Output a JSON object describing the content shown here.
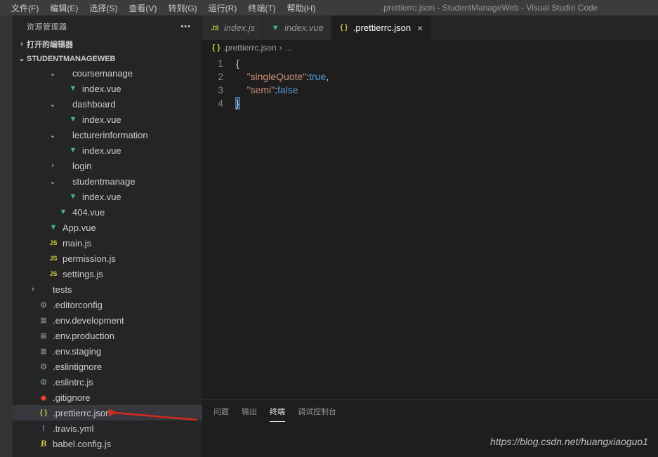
{
  "window": {
    "title": ".prettierrc.json - StudentManageWeb - Visual Studio Code"
  },
  "menu": [
    "文件(F)",
    "编辑(E)",
    "选择(S)",
    "查看(V)",
    "转到(G)",
    "运行(R)",
    "终端(T)",
    "帮助(H)"
  ],
  "sidebar": {
    "title": "资源管理器",
    "section_open_editors": "打开的编辑器",
    "project": "STUDENTMANAGEWEB"
  },
  "tree": [
    {
      "d": 3,
      "c": "down",
      "i": "folder",
      "t": "coursemanage"
    },
    {
      "d": 4,
      "c": "none",
      "i": "vue",
      "t": "index.vue"
    },
    {
      "d": 3,
      "c": "down",
      "i": "folder",
      "t": "dashboard"
    },
    {
      "d": 4,
      "c": "none",
      "i": "vue",
      "t": "index.vue"
    },
    {
      "d": 3,
      "c": "down",
      "i": "folder",
      "t": "lecturerinformation"
    },
    {
      "d": 4,
      "c": "none",
      "i": "vue",
      "t": "index.vue"
    },
    {
      "d": 3,
      "c": "right",
      "i": "folder",
      "t": "login"
    },
    {
      "d": 3,
      "c": "down",
      "i": "folder",
      "t": "studentmanage"
    },
    {
      "d": 4,
      "c": "none",
      "i": "vue",
      "t": "index.vue"
    },
    {
      "d": 3,
      "c": "none",
      "i": "vue",
      "t": "404.vue"
    },
    {
      "d": 2,
      "c": "none",
      "i": "vue",
      "t": "App.vue"
    },
    {
      "d": 2,
      "c": "none",
      "i": "js",
      "t": "main.js"
    },
    {
      "d": 2,
      "c": "none",
      "i": "js",
      "t": "permission.js"
    },
    {
      "d": 2,
      "c": "none",
      "i": "js",
      "t": "settings.js"
    },
    {
      "d": 1,
      "c": "right",
      "i": "folder",
      "t": "tests"
    },
    {
      "d": 1,
      "c": "none",
      "i": "config",
      "t": ".editorconfig"
    },
    {
      "d": 1,
      "c": "none",
      "i": "txt",
      "t": ".env.development"
    },
    {
      "d": 1,
      "c": "none",
      "i": "txt",
      "t": ".env.production"
    },
    {
      "d": 1,
      "c": "none",
      "i": "txt",
      "t": ".env.staging"
    },
    {
      "d": 1,
      "c": "none",
      "i": "config",
      "t": ".eslintignore"
    },
    {
      "d": 1,
      "c": "none",
      "i": "config",
      "t": ".eslintrc.js"
    },
    {
      "d": 1,
      "c": "none",
      "i": "git",
      "t": ".gitignore"
    },
    {
      "d": 1,
      "c": "none",
      "i": "json",
      "t": ".prettierrc.json",
      "sel": true
    },
    {
      "d": 1,
      "c": "none",
      "i": "yml",
      "t": ".travis.yml"
    },
    {
      "d": 1,
      "c": "none",
      "i": "babel",
      "t": "babel.config.js"
    }
  ],
  "tabs": [
    {
      "icon": "js",
      "label": "index.js",
      "active": false
    },
    {
      "icon": "vue",
      "label": "index.vue",
      "active": false
    },
    {
      "icon": "json",
      "label": ".prettierrc.json",
      "active": true
    }
  ],
  "breadcrumb": {
    "file": ".prettierrc.json",
    "sep": "›",
    "rest": "..."
  },
  "code": {
    "lines": [
      "1",
      "2",
      "3",
      "4"
    ],
    "l1_open": "{",
    "l2_key": "\"singleQuote\"",
    "l2_val": "true",
    "l2_comma": ",",
    "l3_key": "\"semi\"",
    "l3_val": "false",
    "l4_close": "}"
  },
  "panel": {
    "tabs": [
      "问题",
      "输出",
      "终端",
      "调试控制台"
    ],
    "activeIndex": 2
  },
  "watermark": "https://blog.csdn.net/huangxiaoguo1"
}
